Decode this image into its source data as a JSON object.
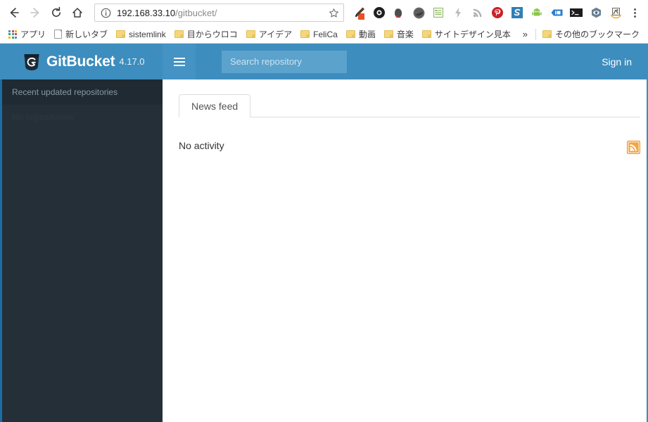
{
  "browser": {
    "nav": {
      "back_label": "Back",
      "forward_label": "Forward",
      "reload_label": "Reload",
      "home_label": "Home"
    },
    "omnibox": {
      "host": "192.168.33.10",
      "path": "/gitbucket/",
      "info_label": "Site information",
      "star_label": "Bookmark this page"
    },
    "extensions": [
      {
        "name": "eyedropper-extension-icon"
      },
      {
        "name": "gear-extension-icon"
      },
      {
        "name": "evernote-extension-icon"
      },
      {
        "name": "circle-extension-icon"
      },
      {
        "name": "notes-extension-icon"
      },
      {
        "name": "lightning-extension-icon"
      },
      {
        "name": "rss-extension-icon"
      },
      {
        "name": "pinterest-extension-icon"
      },
      {
        "name": "s-logo-extension-icon"
      },
      {
        "name": "android-extension-icon"
      },
      {
        "name": "blue-tag-extension-icon"
      },
      {
        "name": "terminal-extension-icon"
      },
      {
        "name": "eye-extension-icon"
      },
      {
        "name": "stamp-extension-icon"
      }
    ],
    "menu_label": "Customize and control",
    "bookmarks": [
      {
        "label": "アプリ",
        "icon": "apps-grid-icon"
      },
      {
        "label": "新しいタブ",
        "icon": "page-icon"
      },
      {
        "label": "sistemlink",
        "icon": "folder-icon"
      },
      {
        "label": "目からウロコ",
        "icon": "folder-icon"
      },
      {
        "label": "アイデア",
        "icon": "folder-icon"
      },
      {
        "label": "FeliCa",
        "icon": "folder-icon"
      },
      {
        "label": "動画",
        "icon": "folder-icon"
      },
      {
        "label": "音楽",
        "icon": "folder-icon"
      },
      {
        "label": "サイトデザイン見本",
        "icon": "folder-icon"
      }
    ],
    "bookmarks_overflow": "»",
    "other_bookmarks": {
      "label": "その他のブックマーク",
      "icon": "folder-icon"
    }
  },
  "gitbucket": {
    "brand": {
      "name": "GitBucket",
      "version": "4.17.0",
      "logo_icon": "gitbucket-shield-icon"
    },
    "menu_toggle_label": "Toggle navigation",
    "search": {
      "placeholder": "Search repository",
      "value": ""
    },
    "signin_label": "Sign in",
    "sidebar": {
      "header": "Recent updated repositories",
      "empty_text": "No repositories"
    },
    "main": {
      "tabs": [
        {
          "label": "News feed",
          "active": true
        }
      ],
      "empty_text": "No activity",
      "feed_icon": "rss-feed-icon"
    },
    "colors": {
      "header_blue": "#3d8dbe",
      "hamburger_blue": "#4493c4",
      "search_blue": "#5ba2cd",
      "sidebar_dark": "#242f38",
      "sidebar_head_dark": "#1f2a32",
      "sidebar_accent": "#1a6ea8",
      "rss_orange": "#f08a24"
    }
  }
}
